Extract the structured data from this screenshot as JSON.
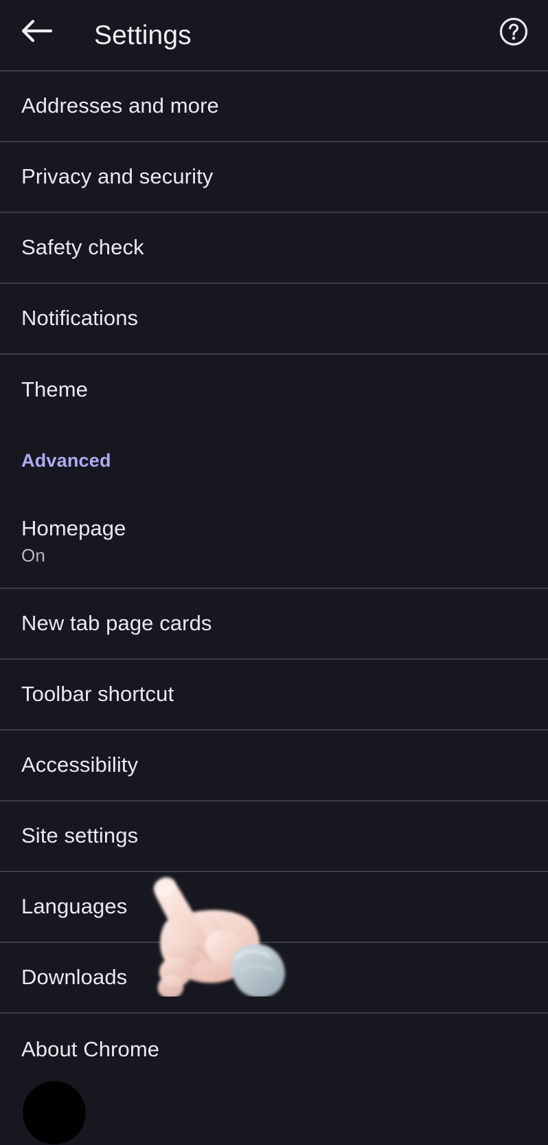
{
  "window": {
    "background_color": "#17171f",
    "divider_color": "#3c3c46"
  },
  "header": {
    "back_icon": "arrow-left-icon",
    "title": "Settings",
    "help_icon": "help-circle-icon",
    "title_color": "#f0f0f5"
  },
  "settings_list": {
    "items": [
      {
        "label": "Addresses and more"
      },
      {
        "label": "Privacy and security"
      },
      {
        "label": "Safety check"
      },
      {
        "label": "Notifications"
      },
      {
        "label": "Theme"
      }
    ],
    "section_header": {
      "label": "Advanced",
      "color": "#aeabf2"
    },
    "advanced_items": [
      {
        "label": "Homepage",
        "sublabel": "On"
      },
      {
        "label": "New tab page cards"
      },
      {
        "label": "Toolbar shortcut"
      },
      {
        "label": "Accessibility"
      },
      {
        "label": "Site settings"
      },
      {
        "label": "Languages"
      },
      {
        "label": "Downloads"
      },
      {
        "label": "About Chrome"
      }
    ]
  },
  "overlay": {
    "cursor_icon": "pointing-hand-cursor",
    "tap_indicator": "tap-blob-indicator",
    "skin_color": "#f6ded6",
    "cuff_color": "#b9c5cd"
  }
}
